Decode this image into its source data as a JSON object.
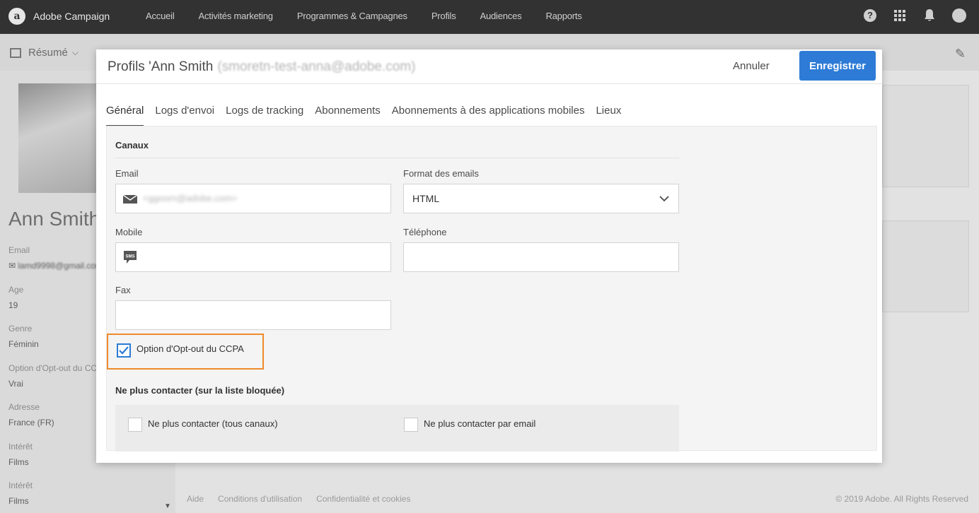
{
  "app": {
    "name": "Adobe Campaign",
    "logo_letter": "a"
  },
  "nav": [
    "Accueil",
    "Activités marketing",
    "Programmes & Campagnes",
    "Profils",
    "Audiences",
    "Rapports"
  ],
  "top_icons": {
    "help": "?"
  },
  "background": {
    "summary_label": "Résumé",
    "profile_name": "Ann Smith",
    "fields": [
      {
        "label": "Email",
        "value": "lamd9998@gmail.com"
      },
      {
        "label": "Age",
        "value": "19"
      },
      {
        "label": "Genre",
        "value": "Féminin"
      },
      {
        "label": "Option d'Opt-out du CC",
        "value": "Vrai"
      },
      {
        "label": "Adresse",
        "value": "France (FR)"
      },
      {
        "label": "Intérêt",
        "value": "Films"
      },
      {
        "label": "Intérêt",
        "value": "Films"
      }
    ],
    "footer_links": [
      "Aide",
      "Conditions d'utilisation",
      "Confidentialité et cookies"
    ],
    "copyright": "© 2019 Adobe. All Rights Reserved"
  },
  "modal": {
    "title": "Profils 'Ann Smith",
    "subtitle": "(smoretn-test-anna@adobe.com)",
    "cancel_label": "Annuler",
    "save_label": "Enregistrer",
    "tabs": [
      "Général",
      "Logs d'envoi",
      "Logs de tracking",
      "Abonnements",
      "Abonnements à des applications mobiles",
      "Lieux"
    ],
    "active_tab": 0,
    "section_canaux": "Canaux",
    "email_label": "Email",
    "email_value": "<ggoorn@adobe.com>",
    "format_label": "Format des emails",
    "format_value": "HTML",
    "mobile_label": "Mobile",
    "mobile_value": "",
    "phone_label": "Téléphone",
    "phone_value": "",
    "fax_label": "Fax",
    "fax_value": "",
    "ccpa_label": "Option d'Opt-out du CCPA",
    "ccpa_checked": true,
    "section_blocked": "Ne plus contacter (sur la liste bloquée)",
    "no_contact_all": "Ne plus contacter (tous canaux)",
    "no_contact_email": "Ne plus contacter par email",
    "sms_icon_text": "SMS"
  },
  "colors": {
    "accent": "#2d7bd6",
    "highlight": "#ef8a2b",
    "topbar": "#323232"
  }
}
